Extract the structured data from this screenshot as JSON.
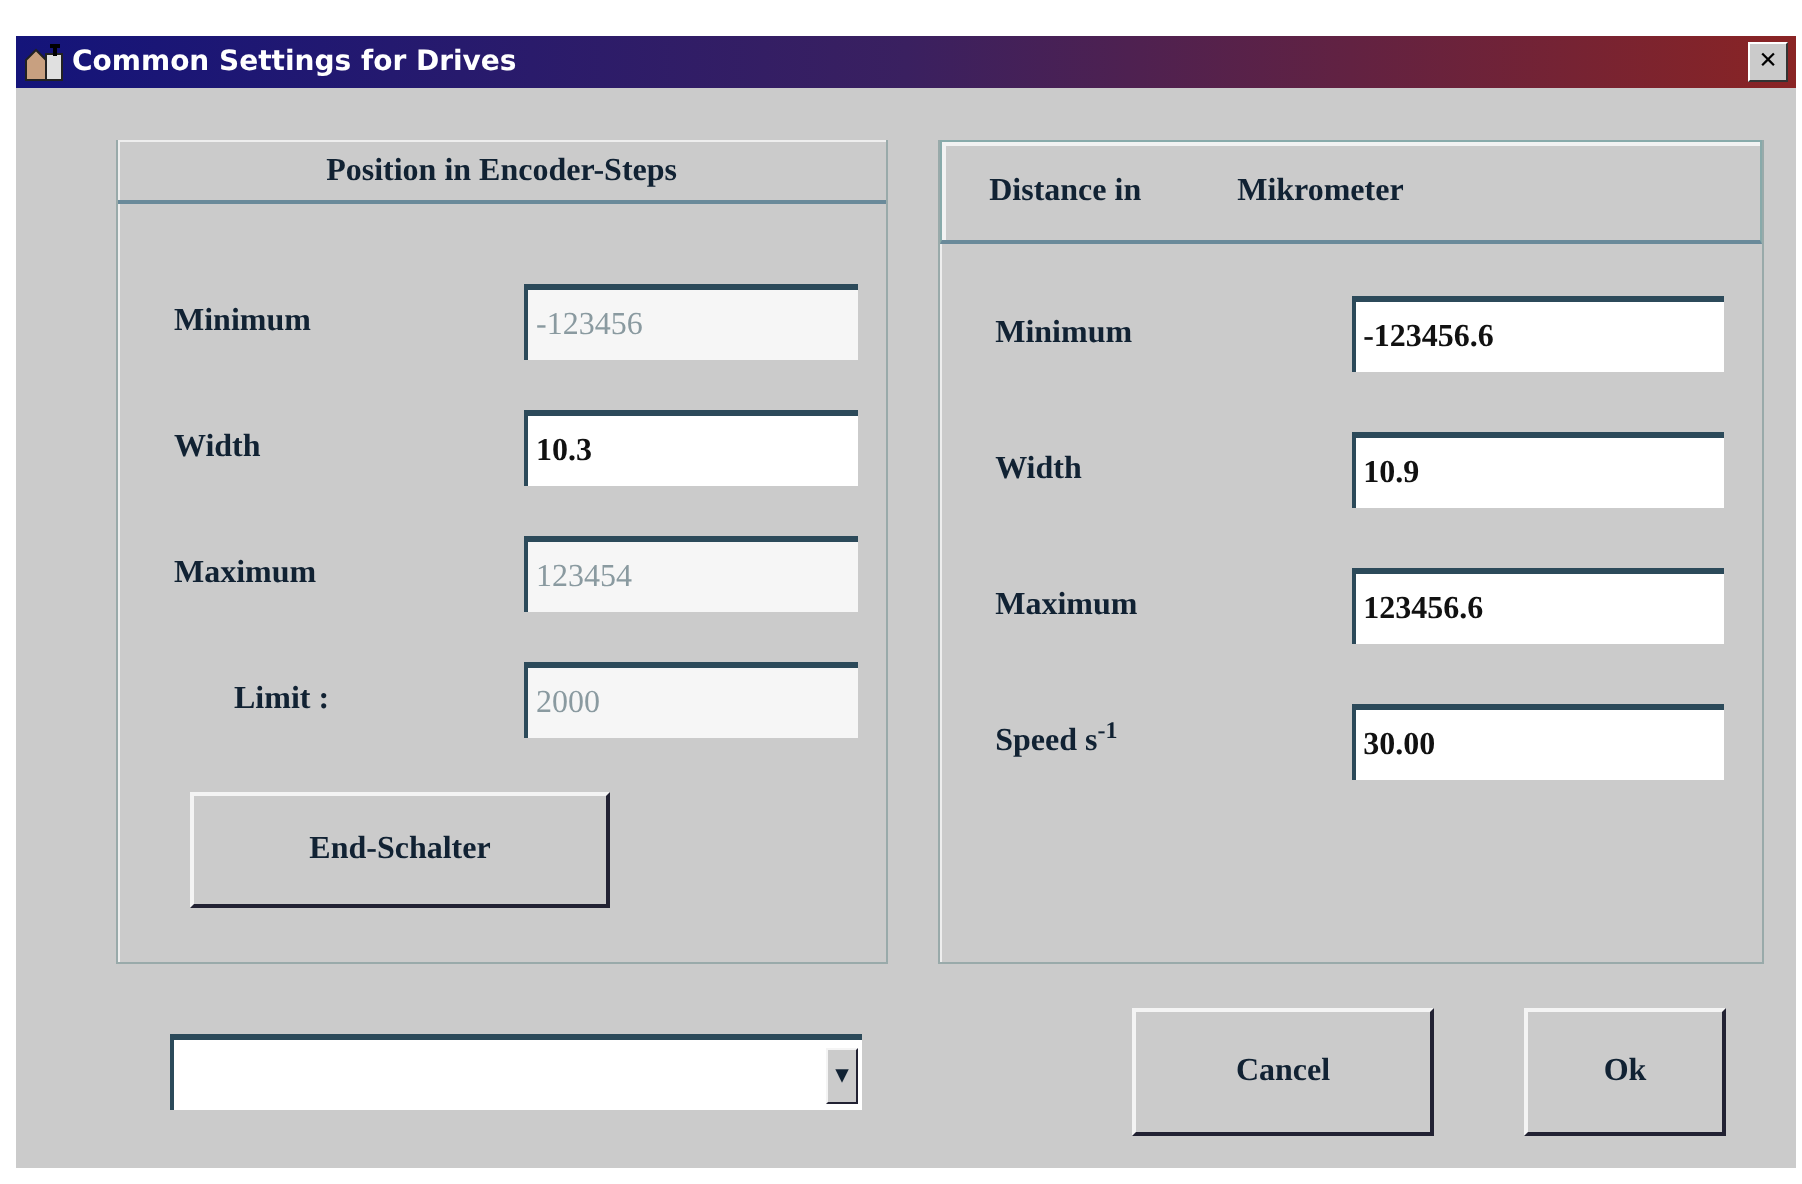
{
  "window": {
    "title": "Common Settings for Drives",
    "close": "×"
  },
  "left_panel": {
    "title": "Position in Encoder-Steps",
    "fields": [
      {
        "label": "Minimum",
        "value": "-123456",
        "disabled": true
      },
      {
        "label": "Width",
        "value": "10.3",
        "disabled": false
      },
      {
        "label": "Maximum",
        "value": "123454",
        "disabled": true
      },
      {
        "label": "Limit :",
        "value": "2000",
        "disabled": true
      }
    ],
    "button": "End-Schalter"
  },
  "right_panel": {
    "header": [
      "Distance in",
      "Mikrometer"
    ],
    "fields": [
      {
        "label": "Minimum",
        "value": "-123456.6",
        "disabled": false
      },
      {
        "label": "Width",
        "value": "10.9",
        "disabled": false
      },
      {
        "label": "Maximum",
        "value": "123456.6",
        "disabled": false
      },
      {
        "label": "Speed s$^{-1}$",
        "value": "30.00",
        "disabled": false
      }
    ]
  },
  "dropdown": {
    "arrow": "▾"
  },
  "buttons": [
    "Cancel",
    "Ok"
  ]
}
